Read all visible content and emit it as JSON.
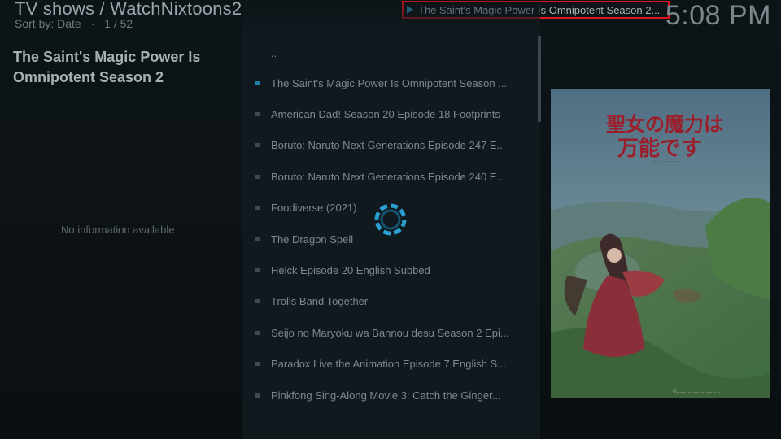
{
  "header": {
    "title": "TV shows / WatchNixtoons2",
    "sort_label": "Sort by: Date",
    "sep": "·",
    "position": "1 / 52"
  },
  "now_playing": {
    "text": "The Saint's Magic Power Is Omnipotent Season 2...",
    "icon": "play-icon",
    "highlight_color": "#e0121b"
  },
  "clock": "5:08 PM",
  "info": {
    "title": "The Saint's Magic Power Is Omnipotent Season 2",
    "no_info": "No information available"
  },
  "list": {
    "items": [
      {
        "label": ".."
      },
      {
        "label": "The Saint's Magic Power Is Omnipotent Season ..."
      },
      {
        "label": "American Dad! Season 20 Episode 18 Footprints"
      },
      {
        "label": "Boruto: Naruto Next Generations Episode 247 E..."
      },
      {
        "label": "Boruto: Naruto Next Generations Episode 240 E..."
      },
      {
        "label": "Foodiverse (2021)"
      },
      {
        "label": "The Dragon Spell"
      },
      {
        "label": "Helck Episode 20 English Subbed"
      },
      {
        "label": "Trolls Band Together"
      },
      {
        "label": "Seijo no Maryoku wa Bannou desu Season 2 Epi..."
      },
      {
        "label": "Paradox Live the Animation Episode 7 English S..."
      },
      {
        "label": "Pinkfong Sing-Along Movie 3: Catch the Ginger..."
      }
    ]
  },
  "colors": {
    "accent": "#1f7fa8",
    "spinner": "#2a9fd0"
  },
  "poster": {
    "title_art": "聖女の魔力は 万能です"
  }
}
